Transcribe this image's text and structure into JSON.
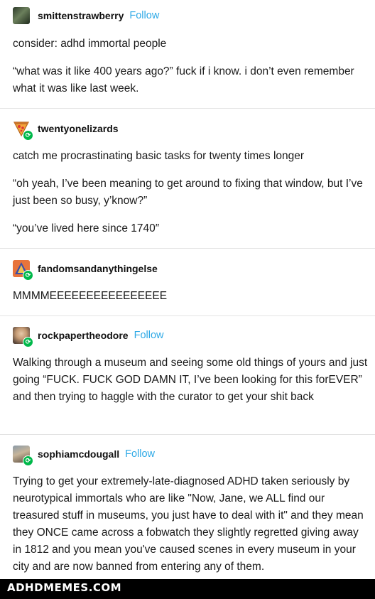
{
  "posts": [
    {
      "username": "smittenstrawberry",
      "follow_label": "Follow",
      "paragraphs": [
        "consider: adhd immortal people",
        "“what was it like 400 years ago?” fuck if i know. i don’t even remember what it was like last week."
      ]
    },
    {
      "username": "twentyonelizards",
      "paragraphs": [
        "catch me procrastinating basic tasks for twenty times longer",
        "“oh yeah, I’ve been meaning to get around to fixing that window, but I’ve just been so busy, y’know?”",
        "“you’ve lived here since 1740″"
      ]
    },
    {
      "username": "fandomsandanythingelse",
      "paragraphs": [
        "MMMMEEEEEEEEEEEEEEEE"
      ]
    },
    {
      "username": "rockpapertheodore",
      "follow_label": "Follow",
      "paragraphs": [
        "Walking through a museum and seeing some old things of yours and just going “FUCK. FUCK GOD DAMN IT, I’ve been looking for this forEVER” and then trying to haggle with the curator to get your shit back"
      ]
    },
    {
      "username": "sophiamcdougall",
      "follow_label": "Follow",
      "paragraphs": [
        "Trying to get your extremely-late-diagnosed ADHD taken seriously by neurotypical immortals who are like \"Now, Jane, we ALL find our treasured stuff in museums, you just have to deal with it\" and they mean they ONCE came across a fobwatch they slightly regretted giving away in 1812 and you mean you've caused scenes in every museum in your city and are now banned from entering any of them."
      ]
    }
  ],
  "footer": {
    "watermark": "ADHDMEMES.COM"
  },
  "colors": {
    "follow": "#2ea9e6",
    "reblog_badge": "#00b84a",
    "divider": "#e3e3e3"
  }
}
